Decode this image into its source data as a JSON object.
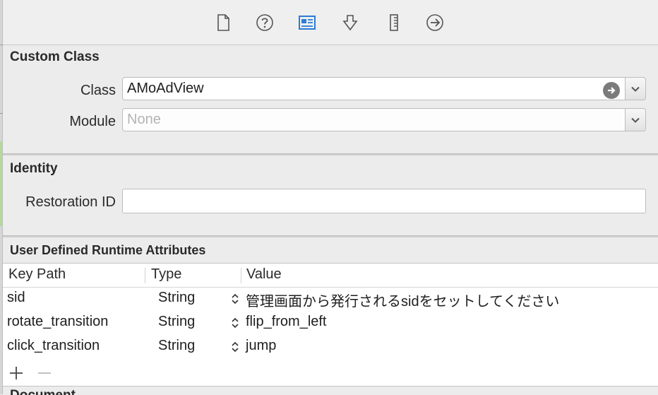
{
  "toolbar": {
    "tabs": [
      {
        "name": "file-inspector",
        "icon": "document-icon",
        "active": false
      },
      {
        "name": "quick-help",
        "icon": "question-icon",
        "active": false
      },
      {
        "name": "identity-inspector",
        "icon": "identity-card-icon",
        "active": true
      },
      {
        "name": "attributes-inspector",
        "icon": "attributes-icon",
        "active": false
      },
      {
        "name": "size-inspector",
        "icon": "ruler-icon",
        "active": false
      },
      {
        "name": "connections-inspector",
        "icon": "arrow-circle-icon",
        "active": false
      }
    ],
    "active_color": "#2b7cd6"
  },
  "custom_class": {
    "title": "Custom Class",
    "class_label": "Class",
    "class_value": "AMoAdView",
    "module_label": "Module",
    "module_placeholder": "None"
  },
  "identity": {
    "title": "Identity",
    "restoration_label": "Restoration ID",
    "restoration_value": ""
  },
  "runtime_attributes": {
    "title": "User Defined Runtime Attributes",
    "columns": [
      "Key Path",
      "Type",
      "Value"
    ],
    "rows": [
      {
        "key_path": "sid",
        "type": "String",
        "value": "管理画面から発行されるsidをセットしてください"
      },
      {
        "key_path": "rotate_transition",
        "type": "String",
        "value": "flip_from_left"
      },
      {
        "key_path": "click_transition",
        "type": "String",
        "value": "jump"
      }
    ]
  },
  "next_section": {
    "title": "Document"
  }
}
